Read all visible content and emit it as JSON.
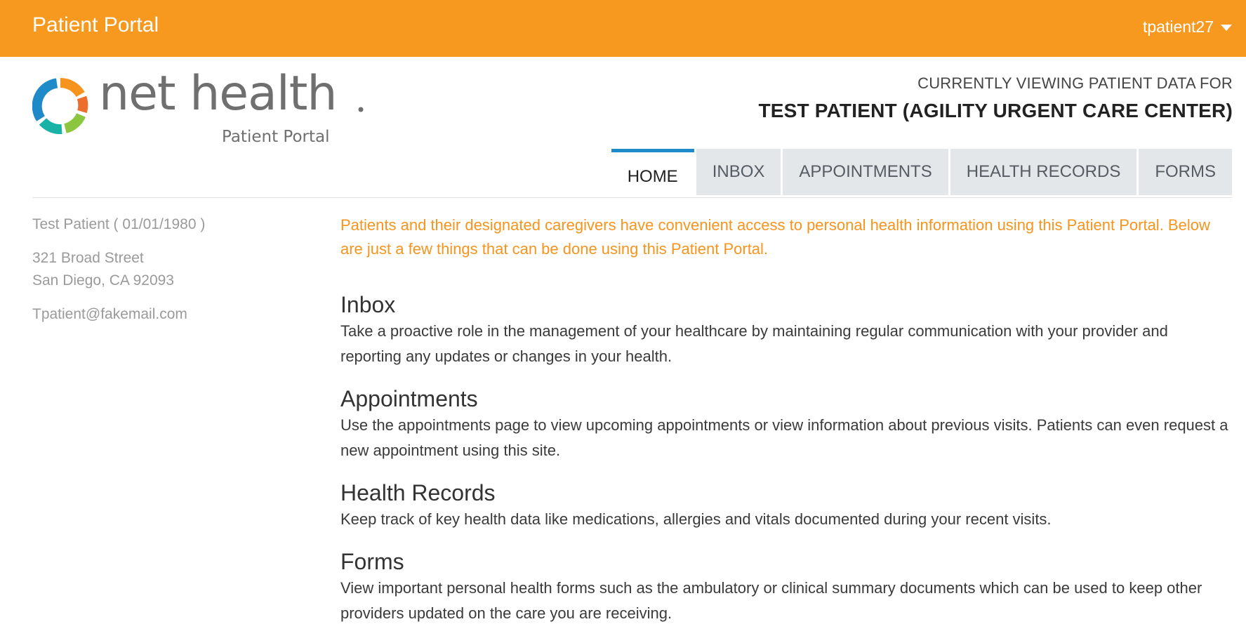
{
  "header": {
    "app_title": "Patient Portal",
    "username": "tpatient27",
    "bar_color": "#f7981f"
  },
  "logo": {
    "word": "net health",
    "subtitle": "Patient Portal",
    "ring_colors": [
      "#1e8ac8",
      "#1ab1a6",
      "#8cc63f",
      "#f7941d",
      "#ec6d2c"
    ]
  },
  "viewing": {
    "label": "CURRENTLY VIEWING PATIENT DATA FOR",
    "name": "TEST PATIENT (AGILITY URGENT CARE CENTER)"
  },
  "tabs": [
    {
      "label": "HOME",
      "active": true
    },
    {
      "label": "INBOX",
      "active": false
    },
    {
      "label": "APPOINTMENTS",
      "active": false
    },
    {
      "label": "HEALTH RECORDS",
      "active": false
    },
    {
      "label": "FORMS",
      "active": false
    }
  ],
  "patient": {
    "name_dob": "Test Patient ( 01/01/1980 )",
    "address_line1": "321 Broad Street",
    "address_line2": "San Diego, CA 92093",
    "email": "Tpatient@fakemail.com"
  },
  "main": {
    "intro": "Patients and their designated caregivers have convenient access to personal health information using this Patient Portal. Below are just a few things that can be done using this Patient Portal.",
    "sections": [
      {
        "title": "Inbox",
        "body": "Take a proactive role in the management of your healthcare by maintaining regular communication with your provider and reporting any updates or changes in your health."
      },
      {
        "title": "Appointments",
        "body": "Use the appointments page to view upcoming appointments or view information about previous visits. Patients can even request a new appointment using this site."
      },
      {
        "title": "Health Records",
        "body": "Keep track of key health data like medications, allergies and vitals documented during your recent visits."
      },
      {
        "title": "Forms",
        "body": "View important personal health forms such as the ambulatory or clinical summary documents which can be used to keep other providers updated on the care you are receiving."
      }
    ]
  },
  "colors": {
    "intro_text": "#f7941d",
    "active_tab_accent": "#1e8ac8",
    "tab_background": "#e4e7ea"
  }
}
